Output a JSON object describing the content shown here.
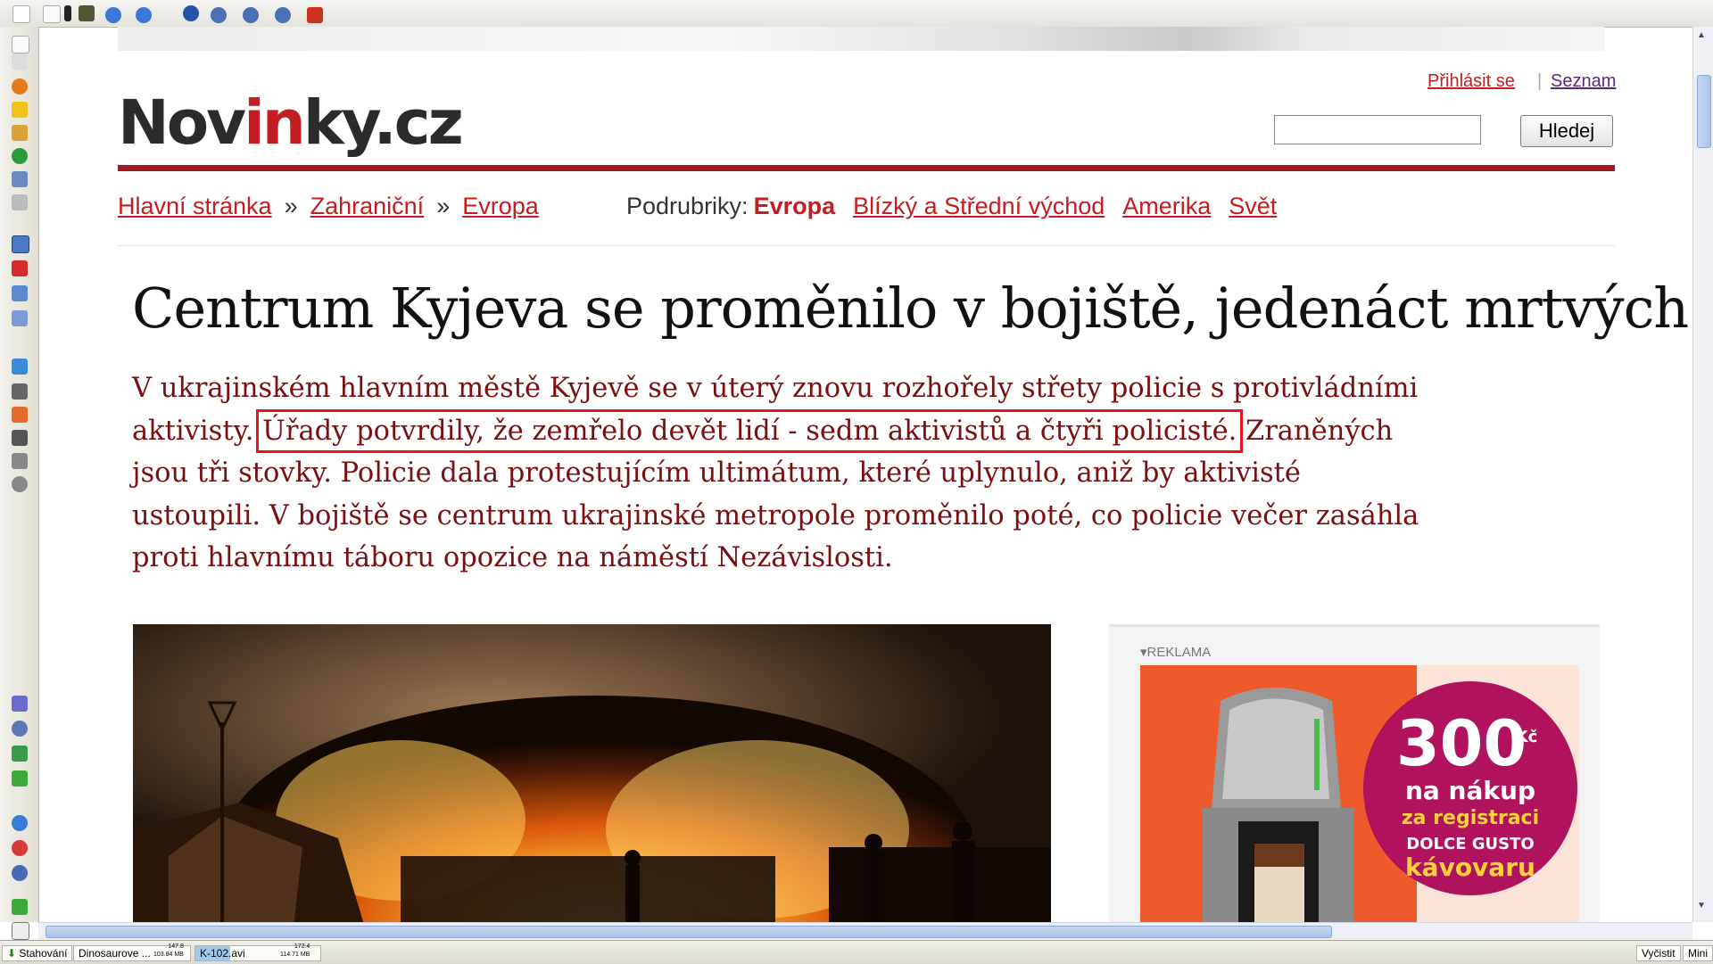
{
  "site": {
    "logo_part1": "Nov",
    "logo_part2": "in",
    "logo_part3": "ky.cz",
    "login": "Přihlásit se",
    "separator": "|",
    "seznam": "Seznam",
    "search_button": "Hledej",
    "search_value": ""
  },
  "breadcrumb": {
    "items": [
      "Hlavní stránka",
      "Zahraniční",
      "Evropa"
    ],
    "separator": "»"
  },
  "subsections": {
    "label": "Podrubriky:",
    "current": "Evropa",
    "items": [
      "Blízký a Střední východ",
      "Amerika",
      "Svět"
    ]
  },
  "article": {
    "headline": "Centrum Kyjeva se proměnilo v bojiště, jedenáct mrtvých",
    "perex_before": "V ukrajinském hlavním městě Kyjevě se v úterý znovu rozhořely střety policie s protivládními aktivisty. ",
    "perex_highlight": "Úřady potvrdily, že zemřelo devět lidí - sedm aktivistů a čtyři policisté.",
    "perex_after": " Zraněných jsou tři stovky. Policie dala protestujícím ultimátum, které uplynulo, aniž by aktivisté ustoupili. V bojiště se centrum ukrajinské metropole proměnilo poté, co policie večer zasáhla proti hlavnímu táboru opozice na náměstí Nezávislosti."
  },
  "ad": {
    "label": "REKLAMA",
    "amount": "300",
    "currency": "Kč",
    "line1": "na nákup",
    "line2": "za registraci",
    "line3": "DOLCE GUSTO",
    "line4": "kávovaru",
    "brand_color": "#ee5a2c",
    "badge_color": "#b0125e"
  },
  "statusbar": {
    "downloads": "Stahování",
    "file1": "Dinosaurove ...",
    "file1_size_top": "147.8",
    "file1_size_bottom": "103.84 MB",
    "file2": "K-102.avi",
    "file2_size_top": "172.4",
    "file2_size_bottom": "114.71 MB",
    "clear": "Vyčistit",
    "mini": "Mini"
  },
  "colors": {
    "accent": "#c21d21",
    "rule": "#9b1b1e",
    "perex": "#7a0e10",
    "highlight_box": "#e8141b"
  }
}
